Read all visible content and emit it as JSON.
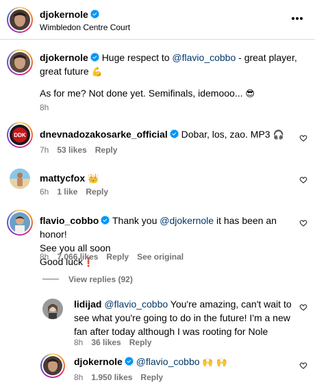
{
  "header": {
    "username": "djokernole",
    "location": "Wimbledon Centre Court",
    "more_icon": "more-horizontal-icon"
  },
  "caption": {
    "username": "djokernole",
    "text_part1": "Huge respect to ",
    "mention": "@flavio_cobbo",
    "text_part2": " - great player,",
    "text_line2": "great future",
    "emoji_line2": "💪",
    "text_line3": "As for me? Not done yet. Semifinals, idemooo...",
    "emoji_line3": "😎",
    "time": "8h"
  },
  "comments": [
    {
      "username": "dnevnadozakosarke_official",
      "verified": true,
      "text": "Dobar, los, zao. MP3",
      "emoji": "🎧",
      "time": "7h",
      "likes": "53 likes",
      "reply": "Reply"
    },
    {
      "username": "mattycfox",
      "verified": false,
      "emoji": "👑",
      "time": "6h",
      "likes": "1 like",
      "reply": "Reply"
    },
    {
      "username": "flavio_cobbo",
      "verified": true,
      "text_part1": "Thank you ",
      "mention": "@djokernole",
      "text_part2": " it has been an honor!",
      "text_line2": "See you all soon",
      "text_line3": "Good luck",
      "emoji": "❗",
      "time": "8h",
      "likes": "7.066 likes",
      "reply": "Reply",
      "see_original": "See original"
    }
  ],
  "view_replies": "View replies (92)",
  "replies": [
    {
      "username": "lidijad",
      "mention": "@flavio_cobbo",
      "text_part1": " You're amazing, can't wait to",
      "text_line2": "see what you're going to do in the future! I'm a new",
      "text_line3": "fan after today although I was rooting for Nole",
      "time": "8h",
      "likes": "36 likes",
      "reply": "Reply"
    },
    {
      "username": "djokernole",
      "verified": true,
      "mention": "@flavio_cobbo",
      "emoji": "🙌 🙌",
      "time": "8h",
      "likes": "1.950 likes",
      "reply": "Reply"
    }
  ],
  "colors": {
    "mention": "#00376b",
    "verified": "#0095f6",
    "meta": "#737373",
    "red_bar": "#e0245e"
  }
}
